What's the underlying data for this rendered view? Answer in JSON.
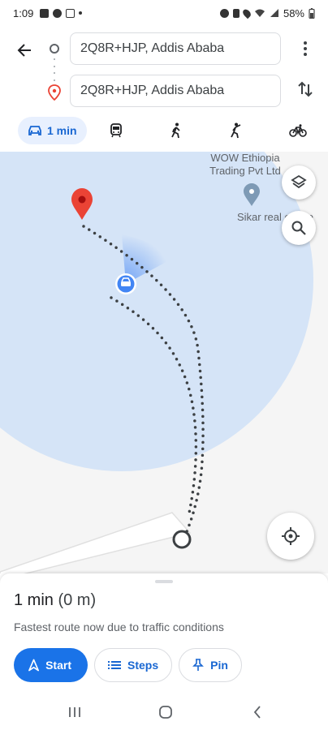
{
  "status_bar": {
    "time": "1:09",
    "battery": "58%"
  },
  "search": {
    "origin_value": "2Q8R+HJP, Addis Ababa",
    "destination_value": "2Q8R+HJP, Addis Ababa"
  },
  "travel_modes": [
    {
      "name": "driving",
      "icon": "car-icon",
      "label": "1 min",
      "selected": true
    },
    {
      "name": "transit",
      "icon": "train-icon"
    },
    {
      "name": "walking",
      "icon": "walk-icon"
    },
    {
      "name": "ride",
      "icon": "ride-hailing-icon"
    },
    {
      "name": "cycling",
      "icon": "bicycle-icon"
    }
  ],
  "map": {
    "labels": {
      "poi_name_line1": "WOW Ethiopia",
      "poi_name_line2": "Trading Pvt Ltd",
      "poi_name_2": "Sikar real estate"
    },
    "colors": {
      "accuracy_circle": "#cfe0f7",
      "route_dots": "#3c4043",
      "destination_pin": "#ea4335",
      "poi_pin": "#7e9ab5",
      "location_blue": "#4285f4"
    }
  },
  "route": {
    "duration": "1 min",
    "distance": "(0 m)",
    "note": "Fastest route now due to traffic conditions"
  },
  "actions": {
    "start": "Start",
    "steps": "Steps",
    "pin": "Pin"
  },
  "colors": {
    "accent": "#1a73e8",
    "accent_text": "#1967d2",
    "chip_bg": "#e8f0fe"
  }
}
